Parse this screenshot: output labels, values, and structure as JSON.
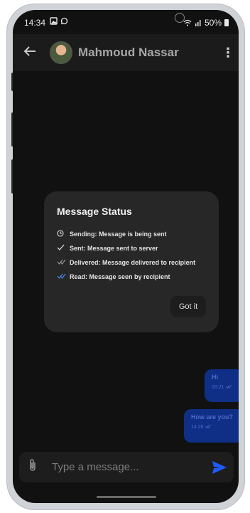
{
  "status": {
    "time": "14:34",
    "left_icons": [
      "image-notification-icon",
      "whatsapp-icon"
    ],
    "right_icons": [
      "wifi-icon",
      "signal-icon",
      "battery-icon"
    ],
    "battery": "50%"
  },
  "header": {
    "contact_name": "Mahmoud Nassar"
  },
  "dialog": {
    "title": "Message Status",
    "rows": [
      {
        "icon": "clock-icon",
        "text": "Sending: Message is being sent"
      },
      {
        "icon": "single-check-icon",
        "text": "Sent: Message sent to server"
      },
      {
        "icon": "double-check-gray-icon",
        "text": "Delivered: Message delivered to recipient"
      },
      {
        "icon": "double-check-blue-icon",
        "text": "Read: Message seen by recipient"
      }
    ],
    "button": "Got it"
  },
  "messages": [
    {
      "text": "Hi",
      "time": "00:21"
    },
    {
      "text": "How are you?",
      "time": "14:26"
    }
  ],
  "composer": {
    "placeholder": "Type a message...",
    "value": ""
  },
  "colors": {
    "accent": "#1f5bff",
    "bubble": "#0f2f87",
    "dialog": "#272727"
  }
}
